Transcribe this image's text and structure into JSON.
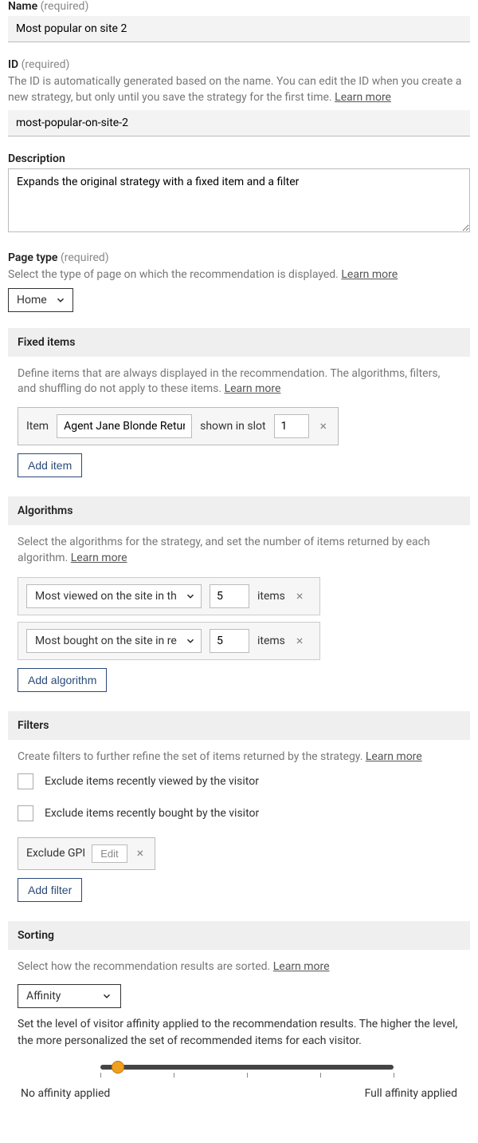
{
  "required_suffix": "(required)",
  "learn_more": "Learn more",
  "name": {
    "label": "Name",
    "value": "Most popular on site 2"
  },
  "id": {
    "label": "ID",
    "help": "The ID is automatically generated based on the name. You can edit the ID when you create a new strategy, but only until you save the strategy for the first time.",
    "value": "most-popular-on-site-2"
  },
  "description": {
    "label": "Description",
    "value": "Expands the original strategy with a fixed item and a filter"
  },
  "page_type": {
    "label": "Page type",
    "help": "Select the type of page on which the recommendation is displayed.",
    "value": "Home"
  },
  "fixed_items": {
    "header": "Fixed items",
    "help": "Define items that are always displayed in the recommendation. The algorithms, filters, and shuffling do not apply to these items.",
    "item_label": "Item",
    "item_value": "Agent Jane Blonde Returns",
    "slot_label": "shown in slot",
    "slot_value": "1",
    "add_btn": "Add item"
  },
  "algorithms": {
    "header": "Algorithms",
    "help": "Select the algorithms for the strategy, and set the number of items returned by each algorithm.",
    "items_label": "items",
    "rows": [
      {
        "name": "Most viewed on the site in the past...",
        "count": "5"
      },
      {
        "name": "Most bought on the site in recent...",
        "count": "5"
      }
    ],
    "add_btn": "Add algorithm"
  },
  "filters": {
    "header": "Filters",
    "help": "Create filters to further refine the set of items returned by the strategy.",
    "checkboxes": [
      "Exclude items recently viewed by the visitor",
      "Exclude items recently bought by the visitor"
    ],
    "chip_label": "Exclude GPI",
    "edit_btn": "Edit",
    "add_btn": "Add filter"
  },
  "sorting": {
    "header": "Sorting",
    "help": "Select how the recommendation results are sorted.",
    "value": "Affinity",
    "affinity_help": "Set the level of visitor affinity applied to the recommendation results. The higher the level, the more personalized the set of recommended items for each visitor.",
    "slider": {
      "value_pct": 6,
      "ticks": [
        0,
        25,
        50,
        75,
        100
      ],
      "left_label": "No affinity applied",
      "right_label": "Full affinity applied"
    }
  }
}
